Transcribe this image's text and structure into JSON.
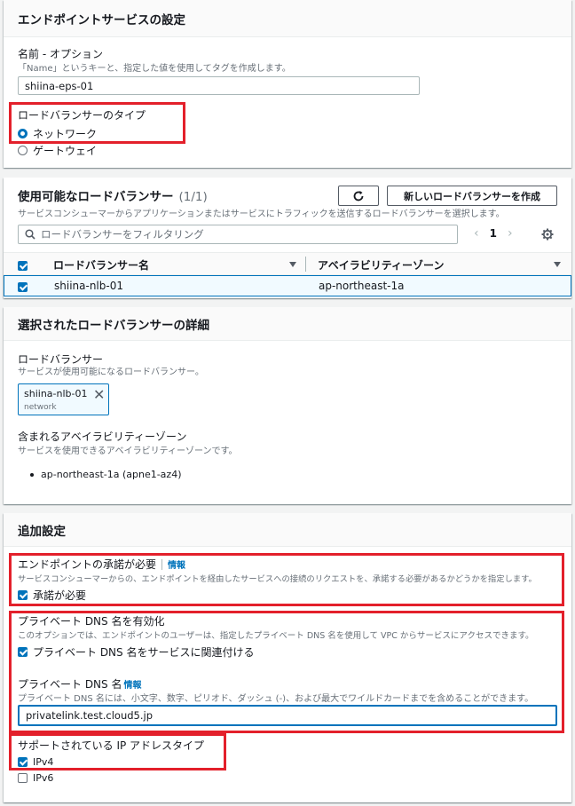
{
  "endpoint_settings": {
    "title": "エンドポイントサービスの設定",
    "name_label": "名前 - オプション",
    "name_desc": "「Name」というキーと、指定した値を使用してタグを作成します。",
    "name_value": "shiina-eps-01",
    "lb_type_label": "ロードバランサーのタイプ",
    "lb_type_options": [
      {
        "label": "ネットワーク",
        "selected": true
      },
      {
        "label": "ゲートウェイ",
        "selected": false
      }
    ]
  },
  "available_lbs": {
    "title": "使用可能なロードバランサー",
    "count": "(1/1)",
    "desc": "サービスコンシューマーからアプリケーションまたはサービスにトラフィックを送信するロードバランサーを選択します。",
    "refresh_icon": "refresh-icon",
    "create_button": "新しいロードバランサーを作成",
    "filter_placeholder": "ロードバランサーをフィルタリング",
    "page": "1",
    "columns": [
      "ロードバランサー名",
      "アベイラビリティーゾーン"
    ],
    "rows": [
      {
        "name": "shiina-nlb-01",
        "az": "ap-northeast-1a",
        "checked": true
      }
    ]
  },
  "selected_lb_details": {
    "title": "選択されたロードバランサーの詳細",
    "lb_label": "ロードバランサー",
    "lb_desc": "サービスが使用可能になるロードバランサー。",
    "token_name": "shiina-nlb-01",
    "token_type": "network",
    "az_label": "含まれるアベイラビリティーゾーン",
    "az_desc": "サービスを使用できるアベイラビリティーゾーンです。",
    "az_items": [
      "ap-northeast-1a (apne1-az4)"
    ]
  },
  "additional_settings": {
    "title": "追加設定",
    "acceptance_label": "エンドポイントの承諾が必要",
    "info_link": "情報",
    "acceptance_desc": "サービスコンシューマーからの、エンドポイントを経由したサービスへの接続のリクエストを、承諾する必要があるかどうかを指定します。",
    "acceptance_checkbox": "承諾が必要",
    "private_dns_label": "プライベート DNS 名を有効化",
    "private_dns_desc": "このオプションでは、エンドポイントのユーザーは、指定したプライベート DNS 名を使用して VPC からサービスにアクセスできます。",
    "private_dns_checkbox": "プライベート DNS 名をサービスに関連付ける",
    "dns_name_label": "プライベート DNS 名",
    "dns_info_link": "情報",
    "dns_name_desc": "プライベート DNS 名には、小文字、数字、ピリオド、ダッシュ (-)、および最大でワイルドカードまでを含めることができます。",
    "dns_name_value": "privatelink.test.cloud5.jp",
    "ip_type_label": "サポートされている IP アドレスタイプ",
    "ip_types": [
      {
        "label": "IPv4",
        "checked": true
      },
      {
        "label": "IPv6",
        "checked": false
      }
    ]
  },
  "colors": {
    "accent": "#0073bb",
    "highlight_box": "#e3202b",
    "page_bg": "#f2f3f3"
  }
}
